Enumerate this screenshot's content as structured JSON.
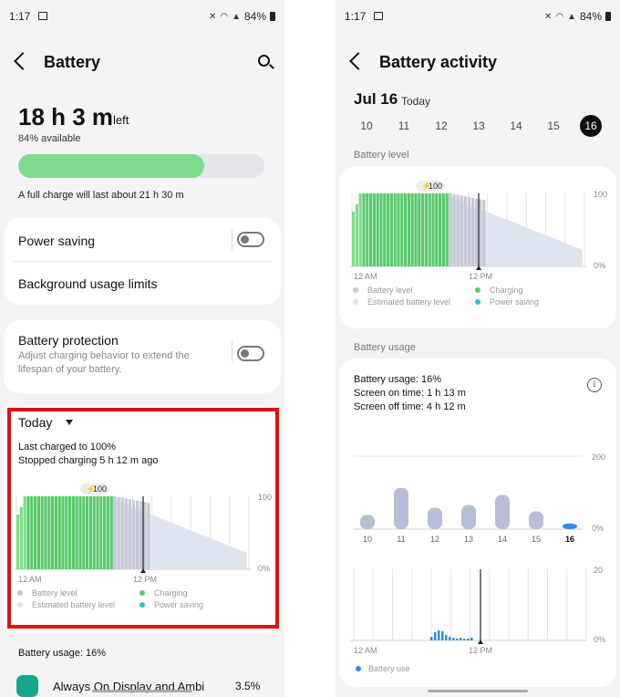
{
  "colors": {
    "charging": "#59c96c",
    "charging_light": "#7fdd8c",
    "level": "#c5c9d8",
    "estimated": "#dfe5ef",
    "saving": "#2cc4cf",
    "usage_bar": "#b7bfd6",
    "usage_sel": "#2f8ee6",
    "highlight": "#e01010"
  },
  "left": {
    "status": {
      "time": "1:17",
      "battery": "84%"
    },
    "header": {
      "title": "Battery"
    },
    "summary": {
      "big": "18 h 3 m",
      "suffix": "left",
      "available": "84% available",
      "full_charge": "A full charge will last about 21 h 30 m",
      "level_pct": 84
    },
    "menu1": {
      "power_saving": "Power saving",
      "background": "Background usage limits"
    },
    "protection": {
      "title": "Battery protection",
      "desc1": "Adjust charging behavior to extend the",
      "desc2": "lifespan of your battery."
    },
    "today": {
      "label": "Today",
      "line1": "Last charged to 100%",
      "line2": "Stopped charging 5 h 12 m ago"
    },
    "chart": {
      "badge": "100",
      "y_top": "100",
      "y_bottom": "0%",
      "x_left": "12 AM",
      "x_mid": "12 PM",
      "legend": {
        "level": "Battery level",
        "estimated": "Estimated battery level",
        "charging": "Charging",
        "saving": "Power saving"
      }
    },
    "usage": {
      "label": "Battery usage: 16%",
      "app": "Always On Display and Ambi",
      "app_pct": "3.5%"
    }
  },
  "right": {
    "status": {
      "time": "1:17",
      "battery": "84%"
    },
    "header": {
      "title": "Battery activity"
    },
    "date": {
      "main": "Jul 16",
      "sub": "Today"
    },
    "days": [
      "10",
      "11",
      "12",
      "13",
      "14",
      "15",
      "16"
    ],
    "section_level": "Battery level",
    "chart": {
      "badge": "100",
      "y_top": "100",
      "y_bottom": "0%",
      "x_left": "12 AM",
      "x_mid": "12 PM",
      "legend": {
        "level": "Battery level",
        "estimated": "Estimated battery level",
        "charging": "Charging",
        "saving": "Power saving"
      }
    },
    "section_usage": "Battery usage",
    "usage": {
      "line1": "Battery usage: 16%",
      "line2": "Screen on time: 1 h 13 m",
      "line3": "Screen off time: 4 h 12 m"
    },
    "daily": {
      "y_top": "200",
      "y_bottom": "0%",
      "days": [
        "10",
        "11",
        "12",
        "13",
        "14",
        "15",
        "16"
      ],
      "values": [
        20,
        58,
        30,
        34,
        48,
        25,
        8
      ]
    },
    "hourly": {
      "y_top": "20",
      "y_bottom": "0%",
      "x_left": "12 AM",
      "x_mid": "12 PM",
      "legend": "Battery use"
    }
  },
  "chart_data": [
    {
      "type": "bar",
      "title": "Battery level",
      "ylim": [
        0,
        100
      ],
      "note": "charging to 100 before noon, then draining; estimated decline to ~20 by end of day"
    },
    {
      "type": "bar",
      "title": "Battery usage",
      "categories": [
        "10",
        "11",
        "12",
        "13",
        "14",
        "15",
        "16"
      ],
      "values": [
        20,
        58,
        30,
        34,
        48,
        25,
        8
      ],
      "ylim": [
        0,
        200
      ]
    }
  ]
}
